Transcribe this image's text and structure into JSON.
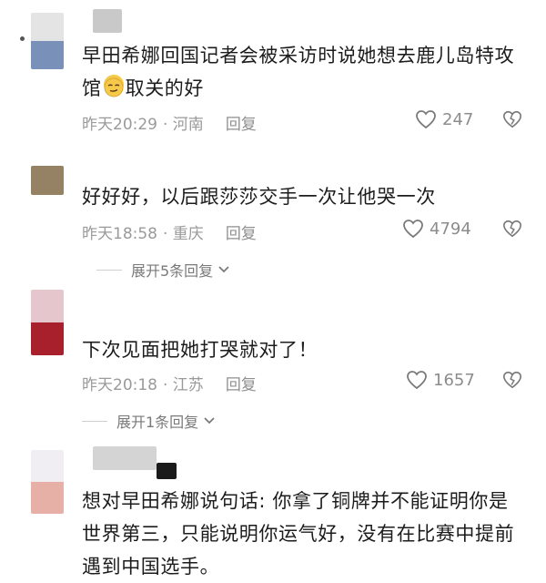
{
  "comments": [
    {
      "line1": "早田希娜回国记者会被采访时说她想去鹿儿岛特攻",
      "line2_before": "馆",
      "line2_after": "取关的好",
      "time": "昨天20:29",
      "location": "· 河南",
      "reply": "回复",
      "likes": "247",
      "emoji": "smirk-face-emoji",
      "avatar_colors": [
        "#e4e4e4",
        "#7990b8"
      ]
    },
    {
      "line1": "好好好，以后跟莎莎交手一次让他哭一次",
      "time": "昨天18:58",
      "location": "· 重庆",
      "reply": "回复",
      "likes": "4794",
      "expand": "展开5条回复",
      "avatar_colors": [
        "#958264",
        "#958264"
      ]
    },
    {
      "line1": "下次见面把她打哭就对了！",
      "time": "昨天20:18",
      "location": "· 江苏",
      "reply": "回复",
      "likes": "1657",
      "expand": "展开1条回复",
      "avatar_colors": [
        "#e5c6cd",
        "#a8202c"
      ]
    },
    {
      "line1": "想对早田希娜说句话: 你拿了铜牌并不能证明你是",
      "line2": "世界第三，只能说明你运气好，没有在比赛中提前",
      "line3": "遇到中国选手。",
      "avatar_colors": [
        "#f0eef2",
        "#e7b0a6"
      ]
    }
  ],
  "colors": {
    "meta_text": "#9a9a9a",
    "body_text": "#1c1c1c"
  }
}
